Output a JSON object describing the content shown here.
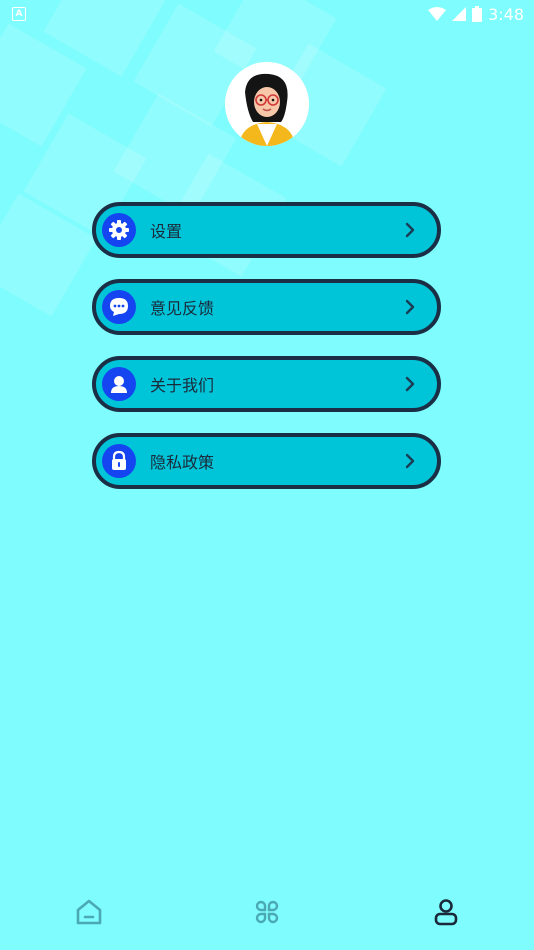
{
  "status_bar": {
    "time": "3:48"
  },
  "menu": {
    "items": [
      {
        "label": "设置",
        "icon": "gear-icon"
      },
      {
        "label": "意见反馈",
        "icon": "chat-bubble-icon"
      },
      {
        "label": "关于我们",
        "icon": "person-icon"
      },
      {
        "label": "隐私政策",
        "icon": "lock-icon"
      }
    ]
  },
  "bottom_nav": {
    "items": [
      {
        "icon": "home-icon",
        "active": false
      },
      {
        "icon": "apps-icon",
        "active": false
      },
      {
        "icon": "profile-icon",
        "active": true
      }
    ]
  },
  "colors": {
    "background": "#7ffcfd",
    "menu_fill": "#00c4d8",
    "menu_border": "#1a2f45",
    "icon_circle": "#1445f0",
    "nav_inactive": "#4aa9b3",
    "nav_active": "#1b2a3a"
  }
}
